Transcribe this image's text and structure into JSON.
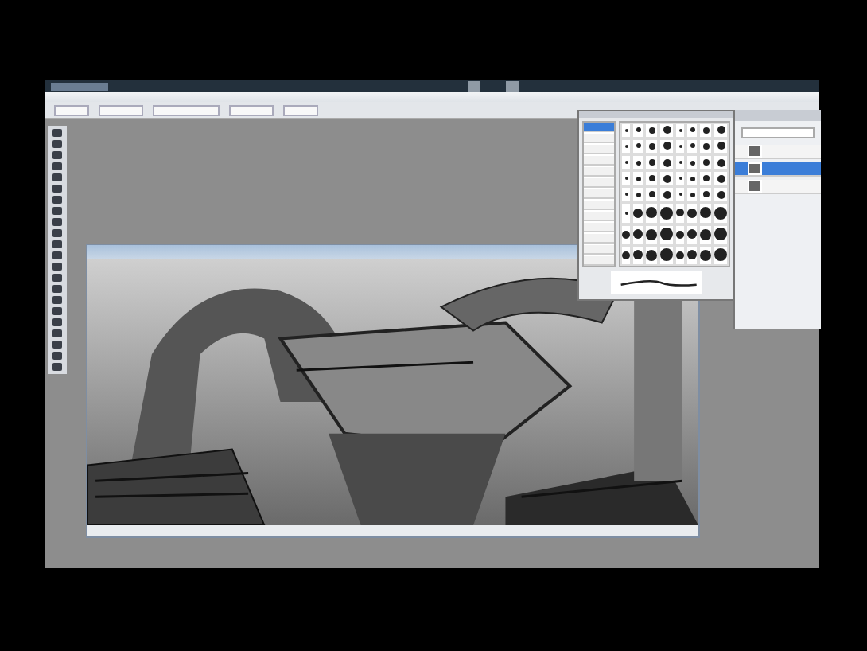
{
  "brushes_panel": {
    "options": [
      {
        "selected": true
      },
      {
        "selected": false
      },
      {
        "selected": false
      },
      {
        "selected": false
      },
      {
        "selected": false
      },
      {
        "selected": false
      },
      {
        "selected": false
      },
      {
        "selected": false
      },
      {
        "selected": false
      },
      {
        "selected": false
      },
      {
        "selected": false
      },
      {
        "selected": false
      },
      {
        "selected": false
      }
    ]
  },
  "layers_panel": {
    "layers": [
      {
        "selected": false
      },
      {
        "selected": true
      },
      {
        "selected": false
      }
    ]
  }
}
